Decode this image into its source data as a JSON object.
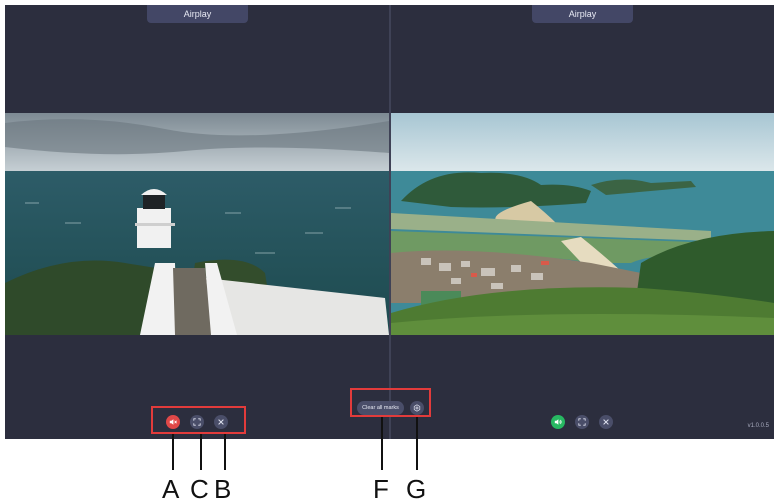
{
  "left_pane": {
    "tab_label": "Airplay",
    "controls": [
      {
        "name": "mute",
        "icon": "speaker-mute-icon",
        "color": "#e04848"
      },
      {
        "name": "fullscreen",
        "icon": "fullscreen-icon"
      },
      {
        "name": "close",
        "icon": "close-icon"
      }
    ]
  },
  "right_pane": {
    "tab_label": "Airplay",
    "controls": [
      {
        "name": "volume",
        "icon": "speaker-on-icon",
        "color": "#27b862"
      },
      {
        "name": "fullscreen",
        "icon": "fullscreen-icon"
      },
      {
        "name": "close",
        "icon": "close-icon"
      }
    ]
  },
  "center_toolbar": {
    "clear_marks_label": "Clear all marks",
    "settings_icon": "settings-icon"
  },
  "version": "v1.0.0.5",
  "callouts": {
    "a": "A",
    "c": "C",
    "b": "B",
    "f": "F",
    "g": "G"
  },
  "colors": {
    "background": "#2c2e3e",
    "tab": "#434766",
    "highlight": "#e23b3b"
  }
}
